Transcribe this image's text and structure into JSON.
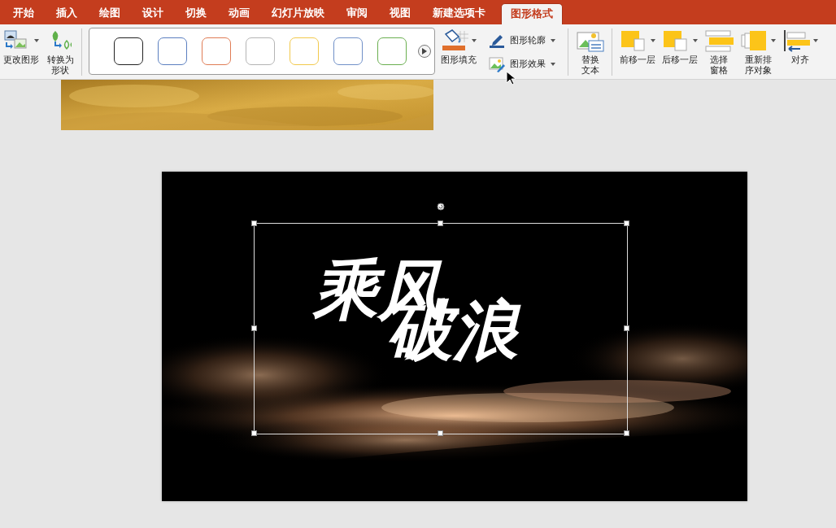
{
  "tabs": [
    {
      "label": "开始",
      "selected": false
    },
    {
      "label": "插入",
      "selected": false
    },
    {
      "label": "绘图",
      "selected": false
    },
    {
      "label": "设计",
      "selected": false
    },
    {
      "label": "切换",
      "selected": false
    },
    {
      "label": "动画",
      "selected": false
    },
    {
      "label": "幻灯片放映",
      "selected": false
    },
    {
      "label": "审阅",
      "selected": false
    },
    {
      "label": "视图",
      "selected": false
    },
    {
      "label": "新建选项卡",
      "selected": false
    },
    {
      "label": "图形格式",
      "selected": true
    }
  ],
  "ribbon": {
    "groups": [
      [
        {
          "kind": "large",
          "lines": [
            "更改图形"
          ],
          "dropdown": true
        },
        {
          "kind": "large",
          "lines": [
            "转换为",
            "形状"
          ],
          "dropdown": false
        }
      ],
      [
        {
          "kind": "gallery",
          "swatches": [
            {
              "color": "#222222"
            },
            {
              "color": "#5b7fc0"
            },
            {
              "color": "#e07c55"
            },
            {
              "color": "#b4b4b4"
            },
            {
              "color": "#f2c94c"
            },
            {
              "color": "#7090c8"
            },
            {
              "color": "#6aaf50"
            }
          ]
        },
        {
          "kind": "large",
          "lines": [
            "图形填充"
          ],
          "dropdown": true
        },
        {
          "kind": "stack",
          "items": [
            {
              "label": "图形轮廓",
              "dropdown": true
            },
            {
              "label": "图形效果",
              "dropdown": true
            }
          ]
        }
      ],
      [
        {
          "kind": "large",
          "lines": [
            "替换",
            "文本"
          ],
          "dropdown": false
        }
      ],
      [
        {
          "kind": "large",
          "lines": [
            "前移一层"
          ],
          "dropdown": true
        },
        {
          "kind": "large",
          "lines": [
            "后移一层"
          ],
          "dropdown": true
        },
        {
          "kind": "large",
          "lines": [
            "选择",
            "窗格"
          ],
          "dropdown": false
        },
        {
          "kind": "large",
          "lines": [
            "重新排",
            "序对象"
          ],
          "dropdown": true
        },
        {
          "kind": "large",
          "lines": [
            "对齐"
          ],
          "dropdown": true
        }
      ]
    ]
  },
  "canvas": {
    "slide": {
      "shape": {
        "lines": [
          "乘风",
          "破浪"
        ],
        "selected": true
      }
    }
  }
}
